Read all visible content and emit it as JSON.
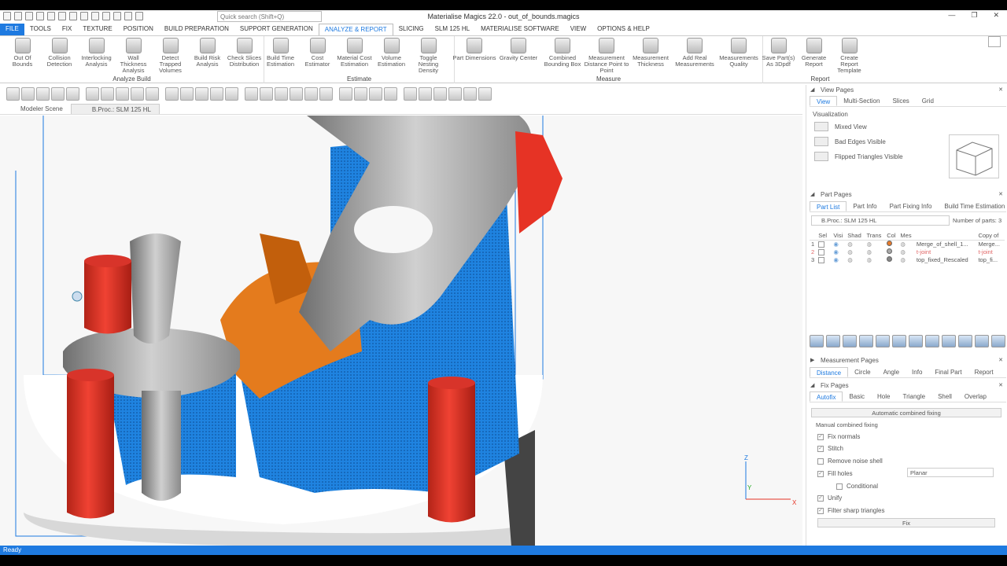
{
  "window": {
    "title": "Materialise Magics 22.0 - out_of_bounds.magics",
    "search_placeholder": "Quick search (Shift+Q)"
  },
  "tabs": [
    "FILE",
    "TOOLS",
    "FIX",
    "TEXTURE",
    "POSITION",
    "BUILD PREPARATION",
    "SUPPORT GENERATION",
    "ANALYZE & REPORT",
    "SLICING",
    "SLM 125 HL",
    "MATERIALISE SOFTWARE",
    "VIEW",
    "OPTIONS & HELP"
  ],
  "active_tab": "ANALYZE & REPORT",
  "ribbon": {
    "analyze_build": {
      "label": "Analyze Build",
      "buttons": [
        "Out Of Bounds",
        "Collision Detection",
        "Interlocking Analysis",
        "Wall Thickness Analysis",
        "Detect Trapped Volumes",
        "Build Risk Analysis",
        "Check Slices Distribution"
      ]
    },
    "estimate": {
      "label": "Estimate",
      "buttons": [
        "Build Time Estimation",
        "Cost Estimator",
        "Material Cost Estimation",
        "Volume Estimation",
        "Toggle Nesting Density"
      ]
    },
    "measure": {
      "label": "Measure",
      "buttons": [
        "Part Dimensions",
        "Gravity Center",
        "Combined Bounding Box",
        "Measurement Distance Point to Point",
        "Measurement Thickness",
        "Add Real Measurements",
        "Measurements Quality"
      ]
    },
    "report": {
      "label": "Report",
      "buttons": [
        "Save Part(s) As 3Dpdf",
        "Generate Report",
        "Create Report Template"
      ]
    }
  },
  "scene_tabs": [
    "Modeler Scene",
    "B.Proc.: SLM 125 HL"
  ],
  "status": "Ready",
  "view_pages": {
    "title": "View Pages",
    "tabs": [
      "View",
      "Multi-Section",
      "Slices",
      "Grid"
    ],
    "section": "Visualization",
    "items": [
      "Mixed View",
      "Bad Edges Visible",
      "Flipped Triangles Visible"
    ]
  },
  "part_pages": {
    "title": "Part Pages",
    "tabs": [
      "Part List",
      "Part Info",
      "Part Fixing Info",
      "Build Time Estimation"
    ],
    "platform": "B.Proc.: SLM 125 HL",
    "parts_label": "Number of parts:",
    "parts_count": "3",
    "columns": [
      "Sel",
      "Visi",
      "Shad",
      "Trans",
      "Col",
      "Mes",
      "",
      "Copy of"
    ],
    "rows": [
      {
        "num": "1",
        "name": "Merge_of_shell_1...",
        "copy": "Merge...",
        "color": "#e87a2a"
      },
      {
        "num": "2",
        "name": "t-joint",
        "copy": "t-joint",
        "color": "#aaaaaa"
      },
      {
        "num": "3",
        "name": "top_fixed_Rescaled",
        "copy": "top_fi...",
        "color": "#888888"
      }
    ]
  },
  "measurement_pages": {
    "title": "Measurement Pages",
    "tabs": [
      "Distance",
      "Circle",
      "Angle",
      "Info",
      "Final Part",
      "Report"
    ]
  },
  "fix_pages": {
    "title": "Fix Pages",
    "tabs": [
      "Autofix",
      "Basic",
      "Hole",
      "Triangle",
      "Shell",
      "Overlap"
    ],
    "auto_button": "Automatic combined fixing",
    "manual_label": "Manual combined fixing",
    "options": [
      {
        "label": "Fix normals",
        "checked": true
      },
      {
        "label": "Stitch",
        "checked": true
      },
      {
        "label": "Remove noise shell",
        "checked": false
      },
      {
        "label": "Fill holes",
        "checked": true
      },
      {
        "label": "Conditional",
        "checked": false
      },
      {
        "label": "Unify",
        "checked": true
      },
      {
        "label": "Filter sharp triangles",
        "checked": true
      }
    ],
    "fill_mode": "Planar",
    "fix_button": "Fix"
  },
  "axes": {
    "z": "Z",
    "y": "Y",
    "x": "X"
  },
  "colors": {
    "accent": "#1e7ae0",
    "support": "#1f83e0",
    "part_red": "#e63325",
    "part_orange": "#e47b1d",
    "part_gray": "#a9a9a9"
  }
}
